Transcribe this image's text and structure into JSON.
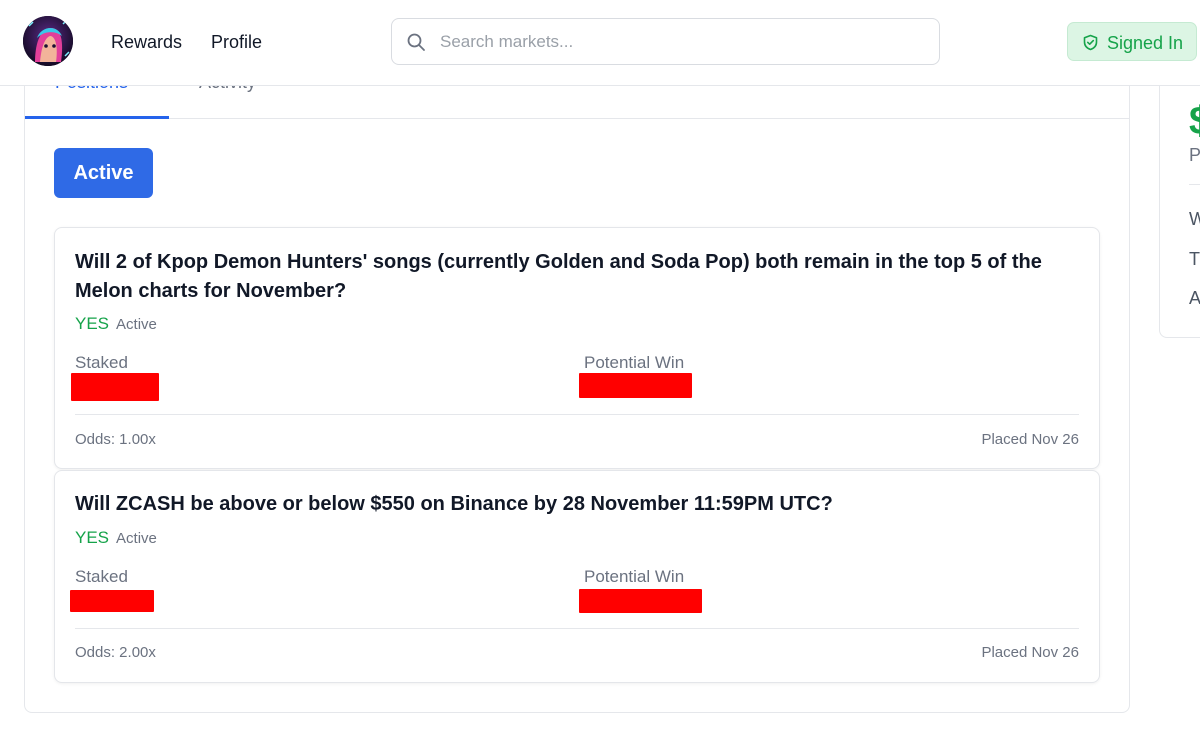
{
  "nav": {
    "rewards": "Rewards",
    "profile": "Profile",
    "search_placeholder": "Search markets...",
    "signed_in": "Signed In"
  },
  "tabs": [
    {
      "label": "Positions",
      "active": true
    },
    {
      "label": "Activity",
      "active": false
    }
  ],
  "filter": {
    "label": "Active"
  },
  "positions": [
    {
      "question": "Will 2 of Kpop Demon Hunters' songs (currently Golden and Soda Pop) both remain in the top 5 of the Melon charts for November?",
      "side": "YES",
      "status": "Active",
      "staked_label": "Staked",
      "potential_label": "Potential Win",
      "odds": "Odds: 1.00x",
      "placed": "Placed Nov 26"
    },
    {
      "question": "Will ZCASH be above or below $550 on Binance by 28 November 11:59PM UTC?",
      "side": "YES",
      "status": "Active",
      "staked_label": "Staked",
      "potential_label": "Potential Win",
      "odds": "Odds: 2.00x",
      "placed": "Placed Nov 26"
    }
  ],
  "side_panel": {
    "big": "$",
    "sub": "P",
    "rows": [
      "W",
      "T",
      "A"
    ]
  },
  "colors": {
    "accent": "#2563eb",
    "yes": "#16a34a",
    "redaction": "#ff0000"
  }
}
